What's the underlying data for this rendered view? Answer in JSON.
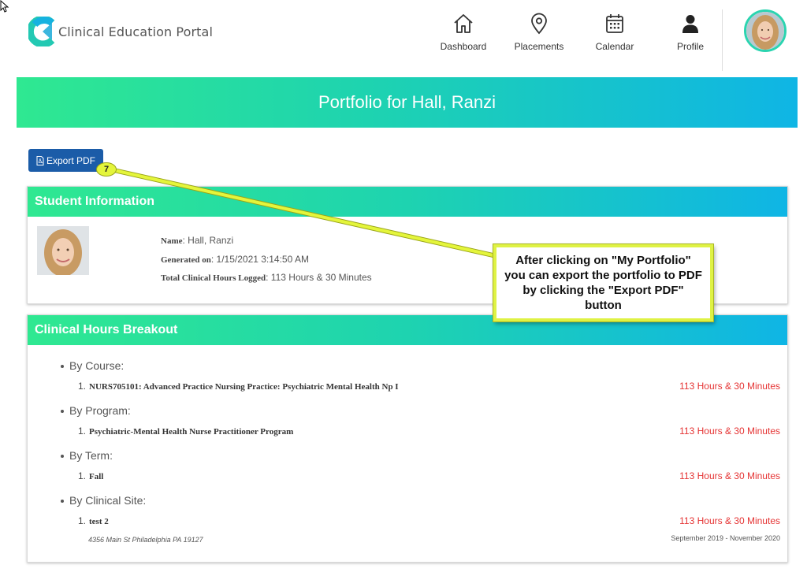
{
  "app": {
    "title": "Clinical Education Portal"
  },
  "nav": [
    {
      "label": "Dashboard",
      "icon": "home-icon"
    },
    {
      "label": "Placements",
      "icon": "location-pin-icon"
    },
    {
      "label": "Calendar",
      "icon": "calendar-icon"
    },
    {
      "label": "Profile",
      "icon": "person-icon"
    }
  ],
  "banner": {
    "title": "Portfolio for Hall, Ranzi"
  },
  "export_button": {
    "label": "Export PDF",
    "icon": "pdf-file-icon"
  },
  "annotation": {
    "step": "7",
    "callout": "After clicking on \"My Portfolio\" you can export the portfolio to PDF by clicking the \"Export PDF\" button",
    "color": "#e4f53b"
  },
  "student_info": {
    "heading": "Student Information",
    "name_label": "Name",
    "name": ": Hall, Ranzi",
    "generated_label": "Generated on",
    "generated": ": 1/15/2021 3:14:50 AM",
    "hours_label": "Total Clinical Hours Logged",
    "hours": ": 113 Hours & 30 Minutes"
  },
  "breakout": {
    "heading": "Clinical Hours Breakout",
    "groups": [
      {
        "label": "By Course:",
        "num": "1.",
        "item": "NURS705101: Advanced Practice Nursing Practice: Psychiatric Mental Health Np I",
        "hours": "113 Hours & 30 Minutes"
      },
      {
        "label": "By Program:",
        "num": "1.",
        "item": "Psychiatric-Mental Health Nurse Practitioner Program",
        "hours": "113 Hours & 30 Minutes"
      },
      {
        "label": "By Term:",
        "num": "1.",
        "item": "Fall",
        "hours": "113 Hours & 30 Minutes"
      },
      {
        "label": "By Clinical Site:",
        "num": "1.",
        "item": "test 2",
        "hours": "113 Hours & 30 Minutes",
        "address": "4356 Main St Philadelphia PA 19127",
        "dates": "September 2019 - November 2020"
      }
    ]
  },
  "colors": {
    "accent_start": "#2fe891",
    "accent_end": "#0fb5e5",
    "button": "#1b5ca8",
    "hours_text": "#e53333"
  }
}
